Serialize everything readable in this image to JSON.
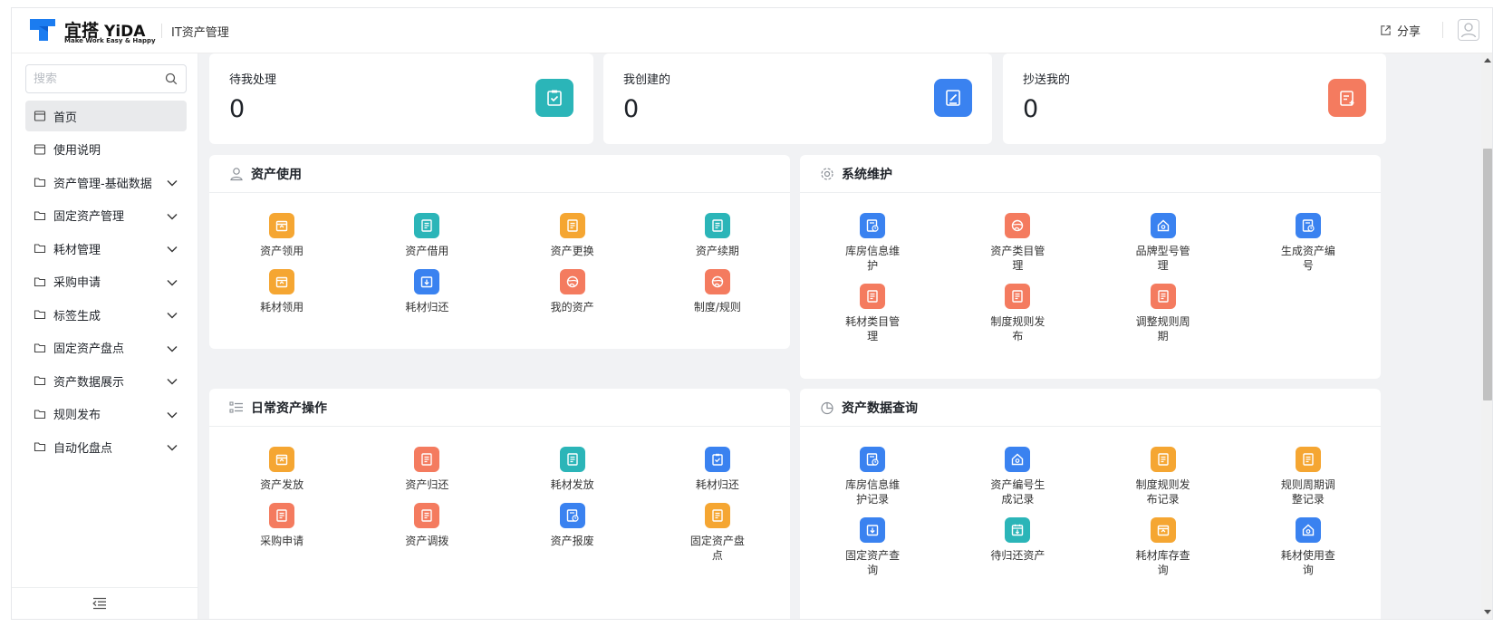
{
  "header": {
    "brand_cn": "宜搭",
    "brand_en": "YiDA",
    "slogan": "Make Work Easy & Happy",
    "app_title": "IT资产管理",
    "share_label": "分享"
  },
  "sidebar": {
    "search_placeholder": "搜索",
    "items": [
      {
        "label": "首页",
        "icon": "page-icon",
        "active": true
      },
      {
        "label": "使用说明",
        "icon": "page-icon"
      },
      {
        "label": "资产管理-基础数据",
        "icon": "folder-icon",
        "expandable": true
      },
      {
        "label": "固定资产管理",
        "icon": "folder-icon",
        "expandable": true
      },
      {
        "label": "耗材管理",
        "icon": "folder-icon",
        "expandable": true
      },
      {
        "label": "采购申请",
        "icon": "folder-icon",
        "expandable": true
      },
      {
        "label": "标签生成",
        "icon": "folder-icon",
        "expandable": true
      },
      {
        "label": "固定资产盘点",
        "icon": "folder-icon",
        "expandable": true
      },
      {
        "label": "资产数据展示",
        "icon": "folder-icon",
        "expandable": true
      },
      {
        "label": "规则发布",
        "icon": "folder-icon",
        "expandable": true
      },
      {
        "label": "自动化盘点",
        "icon": "folder-icon",
        "expandable": true
      }
    ]
  },
  "stats": [
    {
      "label": "待我处理",
      "value": "0",
      "color": "#2bb5b8",
      "icon": "clipboard-check-icon"
    },
    {
      "label": "我创建的",
      "value": "0",
      "color": "#3a82f0",
      "icon": "edit-doc-icon"
    },
    {
      "label": "抄送我的",
      "value": "0",
      "color": "#f47b5f",
      "icon": "copy-doc-icon"
    }
  ],
  "panels": {
    "asset_use": {
      "title": "资产使用",
      "icon": "user-icon",
      "tiles": [
        {
          "label": "资产领用",
          "color": "#f5a632",
          "icon": "box-icon"
        },
        {
          "label": "资产借用",
          "color": "#2bb5b8",
          "icon": "doc-icon"
        },
        {
          "label": "资产更换",
          "color": "#f5a632",
          "icon": "doc-icon"
        },
        {
          "label": "资产续期",
          "color": "#2bb5b8",
          "icon": "doc-icon"
        },
        {
          "label": "耗材领用",
          "color": "#f5a632",
          "icon": "box-icon"
        },
        {
          "label": "耗材归还",
          "color": "#3a82f0",
          "icon": "download-icon"
        },
        {
          "label": "我的资产",
          "color": "#f47b5f",
          "icon": "globe-icon"
        },
        {
          "label": "制度/规则",
          "color": "#f47b5f",
          "icon": "globe-icon"
        }
      ]
    },
    "system": {
      "title": "系统维护",
      "icon": "gear-icon",
      "tiles": [
        {
          "label": "库房信息维护",
          "color": "#3a82f0",
          "icon": "doc-clock-icon"
        },
        {
          "label": "资产类目管理",
          "color": "#f47b5f",
          "icon": "globe-icon"
        },
        {
          "label": "品牌型号管理",
          "color": "#3a82f0",
          "icon": "home-icon"
        },
        {
          "label": "生成资产编号",
          "color": "#3a82f0",
          "icon": "doc-clock-icon"
        },
        {
          "label": "耗材类目管理",
          "color": "#f47b5f",
          "icon": "doc-icon"
        },
        {
          "label": "制度规则发布",
          "color": "#f47b5f",
          "icon": "doc-icon"
        },
        {
          "label": "调整规则周期",
          "color": "#f47b5f",
          "icon": "doc-icon"
        }
      ]
    },
    "daily": {
      "title": "日常资产操作",
      "icon": "list-icon",
      "tiles": [
        {
          "label": "资产发放",
          "color": "#f5a632",
          "icon": "box-icon"
        },
        {
          "label": "资产归还",
          "color": "#f47b5f",
          "icon": "doc-icon"
        },
        {
          "label": "耗材发放",
          "color": "#2bb5b8",
          "icon": "doc-icon"
        },
        {
          "label": "耗材归还",
          "color": "#3a82f0",
          "icon": "clipboard-check-icon"
        },
        {
          "label": "采购申请",
          "color": "#f47b5f",
          "icon": "doc-icon"
        },
        {
          "label": "资产调拨",
          "color": "#f47b5f",
          "icon": "doc-icon"
        },
        {
          "label": "资产报废",
          "color": "#3a82f0",
          "icon": "doc-clock-icon"
        },
        {
          "label": "固定资产盘点",
          "color": "#f5a632",
          "icon": "doc-icon"
        }
      ]
    },
    "query": {
      "title": "资产数据查询",
      "icon": "pie-icon",
      "tiles": [
        {
          "label": "库房信息维护记录",
          "color": "#3a82f0",
          "icon": "doc-clock-icon"
        },
        {
          "label": "资产编号生成记录",
          "color": "#3a82f0",
          "icon": "home-icon"
        },
        {
          "label": "制度规则发布记录",
          "color": "#f5a632",
          "icon": "doc-icon"
        },
        {
          "label": "规则周期调整记录",
          "color": "#f5a632",
          "icon": "doc-icon"
        },
        {
          "label": "固定资产查询",
          "color": "#3a82f0",
          "icon": "download-icon"
        },
        {
          "label": "待归还资产",
          "color": "#2bb5b8",
          "icon": "calendar-icon"
        },
        {
          "label": "耗材库存查询",
          "color": "#f5a632",
          "icon": "box-icon"
        },
        {
          "label": "耗材使用查询",
          "color": "#3a82f0",
          "icon": "home-icon"
        }
      ]
    }
  }
}
